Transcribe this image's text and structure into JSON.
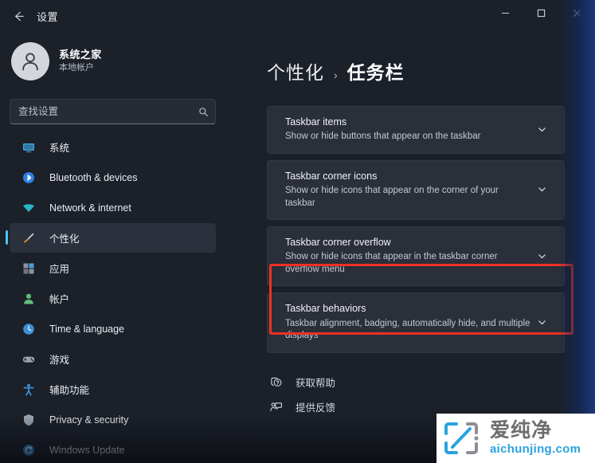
{
  "window": {
    "app_title": "设置",
    "back_icon": "back-arrow-icon",
    "controls": {
      "minimize": "minimize-icon",
      "maximize": "maximize-icon",
      "close": "close-icon"
    }
  },
  "sidebar": {
    "account": {
      "name": "系统之家",
      "subtitle": "本地帐户",
      "avatar_icon": "person-avatar-icon"
    },
    "search": {
      "placeholder": "查找设置",
      "value": "",
      "icon": "search-icon"
    },
    "items": [
      {
        "label": "系统",
        "icon": "monitor-icon",
        "color": "#3ea5e0",
        "selected": false
      },
      {
        "label": "Bluetooth & devices",
        "icon": "bluetooth-icon",
        "color": "#2f7fe0",
        "selected": false
      },
      {
        "label": "Network & internet",
        "icon": "wifi-icon",
        "color": "#2bb3c8",
        "selected": false
      },
      {
        "label": "个性化",
        "icon": "paintbrush-icon",
        "color": "#e08b3a",
        "selected": true
      },
      {
        "label": "应用",
        "icon": "apps-icon",
        "color": "#8b93a0",
        "selected": false
      },
      {
        "label": "帐户",
        "icon": "account-icon",
        "color": "#5fbf7a",
        "selected": false
      },
      {
        "label": "Time & language",
        "icon": "clock-icon",
        "color": "#3d8fd6",
        "selected": false
      },
      {
        "label": "游戏",
        "icon": "gamepad-icon",
        "color": "#9aa3b0",
        "selected": false
      },
      {
        "label": "辅助功能",
        "icon": "accessibility-icon",
        "color": "#3d8fd6",
        "selected": false
      },
      {
        "label": "Privacy & security",
        "icon": "shield-icon",
        "color": "#9aa3b0",
        "selected": false
      },
      {
        "label": "Windows Update",
        "icon": "update-icon",
        "color": "#2f8fe0",
        "selected": false
      }
    ]
  },
  "main": {
    "breadcrumb": {
      "parent": "个性化",
      "separator": "›",
      "current": "任务栏"
    },
    "cards": [
      {
        "title": "Taskbar items",
        "subtitle": "Show or hide buttons that appear on the taskbar",
        "chevron": "chevron-down-icon",
        "highlighted": false
      },
      {
        "title": "Taskbar corner icons",
        "subtitle": "Show or hide icons that appear on the corner of your taskbar",
        "chevron": "chevron-down-icon",
        "highlighted": false
      },
      {
        "title": "Taskbar corner overflow",
        "subtitle": "Show or hide icons that appear in the taskbar corner overflow menu",
        "chevron": "chevron-down-icon",
        "highlighted": false
      },
      {
        "title": "Taskbar behaviors",
        "subtitle": "Taskbar alignment, badging, automatically hide, and multiple displays",
        "chevron": "chevron-down-icon",
        "highlighted": true
      }
    ],
    "highlight_color": "#ee3124",
    "links": [
      {
        "label": "获取帮助",
        "icon": "help-icon"
      },
      {
        "label": "提供反馈",
        "icon": "feedback-icon"
      }
    ]
  },
  "watermark": {
    "logo_icon": "bracket-logo-icon",
    "cn_text": "爱纯净",
    "en_text": "aichunjing.com",
    "cn_color": "#6d6e70",
    "en_color": "#2aa3e0"
  }
}
